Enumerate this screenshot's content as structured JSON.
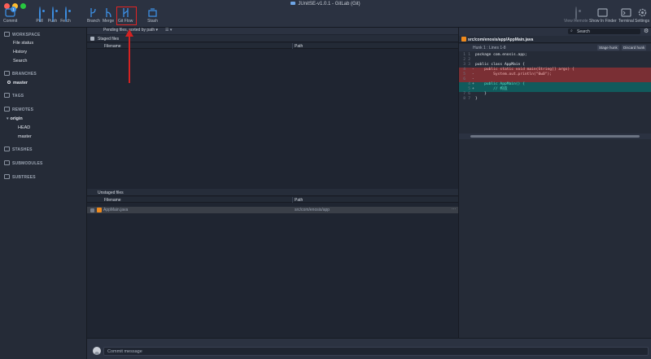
{
  "window": {
    "title": "JUnitSE-v1.0.1 - GitLab (Git)"
  },
  "toolbar": {
    "commit": "Commit",
    "commit_badge": "1",
    "pull": "Pull",
    "push": "Push",
    "fetch": "Fetch",
    "branch": "Branch",
    "merge": "Merge",
    "git_flow": "Git Flow",
    "stash": "Stash",
    "view_remote": "View Remote",
    "show_in_finder": "Show In Finder",
    "terminal": "Terminal",
    "settings": "Settings"
  },
  "sidebar": {
    "workspace": "WORKSPACE",
    "file_status": "File status",
    "history": "History",
    "search": "Search",
    "branches": "BRANCHES",
    "master": "master",
    "tags": "TAGS",
    "remotes": "REMOTES",
    "origin": "origin",
    "head": "HEAD",
    "origin_master": "master",
    "stashes": "STASHES",
    "submodules": "SUBMODULES",
    "subtrees": "SUBTREES"
  },
  "filter": {
    "label": "Pending files, sorted by path"
  },
  "staged": {
    "title": "Staged files",
    "col_filename": "Filename",
    "col_path": "Path"
  },
  "unstaged": {
    "title": "Unstaged files",
    "col_filename": "Filename",
    "col_path": "Path",
    "files": [
      {
        "name": "AppMain.java",
        "path": "src/com/enosis/app",
        "more": "···"
      }
    ]
  },
  "search": {
    "placeholder": "Search"
  },
  "diff": {
    "file_path": "src/com/enosis/app/AppMain.java",
    "hunk_label": "Hunk 1 : Lines 1-8",
    "stage_hunk": "Stage hunk",
    "discard_hunk": "Discard hunk",
    "lines": [
      {
        "old": "1",
        "new": "1",
        "type": "ctx",
        "text": "package com.enosis.app;"
      },
      {
        "old": "2",
        "new": "2",
        "type": "ctx",
        "text": ""
      },
      {
        "old": "3",
        "new": "3",
        "type": "ctx",
        "text": "public class AppMain {"
      },
      {
        "old": "4",
        "new": "",
        "type": "del",
        "text": "    public static void main(String[] args) {"
      },
      {
        "old": "5",
        "new": "",
        "type": "del",
        "text": "        System.out.println(\"0w0\");"
      },
      {
        "old": "6",
        "new": "",
        "type": "del",
        "text": ""
      },
      {
        "old": "",
        "new": "4",
        "type": "add",
        "text": "    public AppMain() {"
      },
      {
        "old": "",
        "new": "5",
        "type": "add",
        "text": "        // 构造"
      },
      {
        "old": "7",
        "new": "6",
        "type": "ctx",
        "text": "    }"
      },
      {
        "old": "8",
        "new": "7",
        "type": "ctx",
        "text": "}"
      }
    ]
  },
  "commit": {
    "placeholder": "Commit message"
  },
  "colors": {
    "accent": "#3d8fe3",
    "highlight": "#e02525",
    "deleted": "#7a2f34",
    "added": "#115a5c"
  }
}
